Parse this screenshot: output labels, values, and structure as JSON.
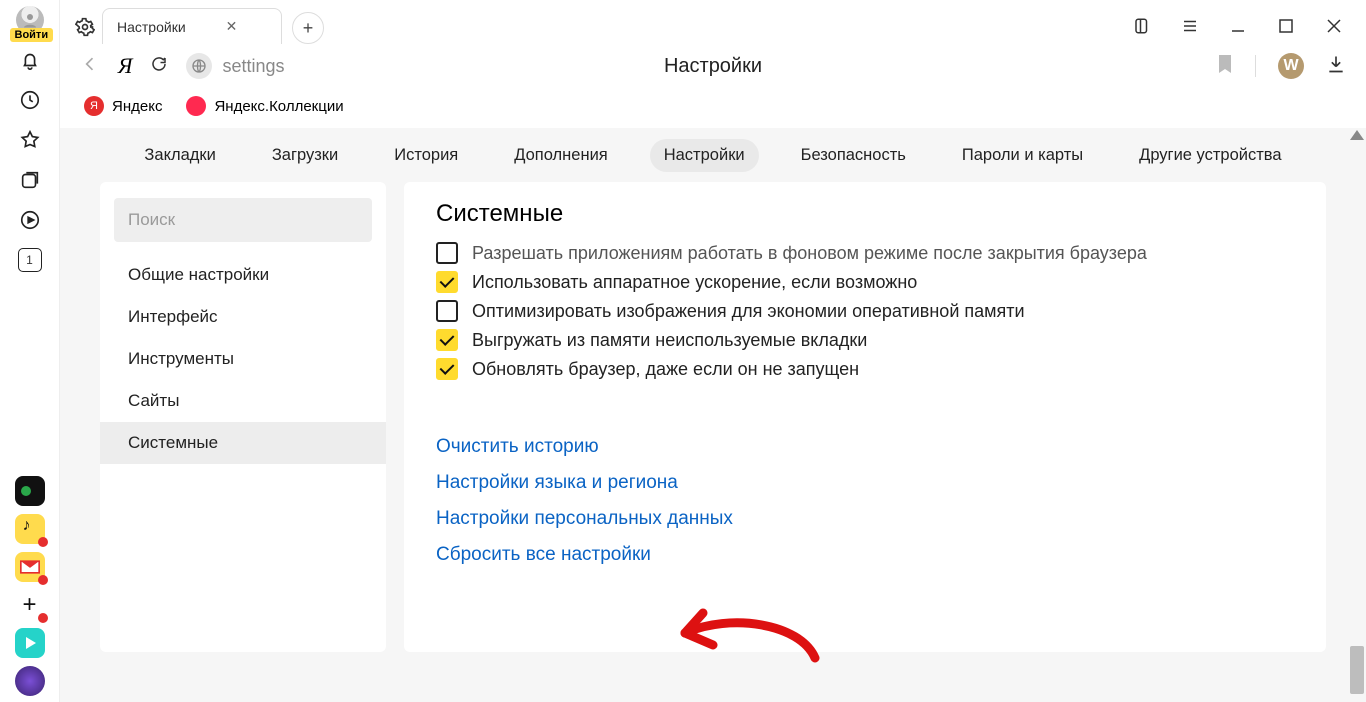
{
  "login_label": "Войти",
  "left_badge_number": "1",
  "tab": {
    "title": "Настройки"
  },
  "url_text": "settings",
  "page_header": "Настройки",
  "w_letter": "W",
  "bookmarks": {
    "yandex": "Яндекс",
    "collections": "Яндекс.Коллекции"
  },
  "top_nav": {
    "zakladki": "Закладки",
    "zagruzki": "Загрузки",
    "istoriya": "История",
    "dopolneniya": "Дополнения",
    "nastroiki": "Настройки",
    "bezopasnost": "Безопасность",
    "paroli": "Пароли и карты",
    "drugie": "Другие устройства"
  },
  "search_placeholder": "Поиск",
  "side_nav": {
    "obshie": "Общие настройки",
    "interfeis": "Интерфейс",
    "instrumenty": "Инструменты",
    "saity": "Сайты",
    "sistemnye": "Системные"
  },
  "section_title": "Системные",
  "options": {
    "bg": "Разрешать приложениям работать в фоновом режиме после закрытия браузера",
    "hw": "Использовать аппаратное ускорение, если возможно",
    "opt_img": "Оптимизировать изображения для экономии оперативной памяти",
    "unload": "Выгружать из памяти неиспользуемые вкладки",
    "update": "Обновлять браузер, даже если он не запущен"
  },
  "links": {
    "clear": "Очистить историю",
    "lang": "Настройки языка и региона",
    "personal": "Настройки персональных данных",
    "reset": "Сбросить все настройки"
  }
}
